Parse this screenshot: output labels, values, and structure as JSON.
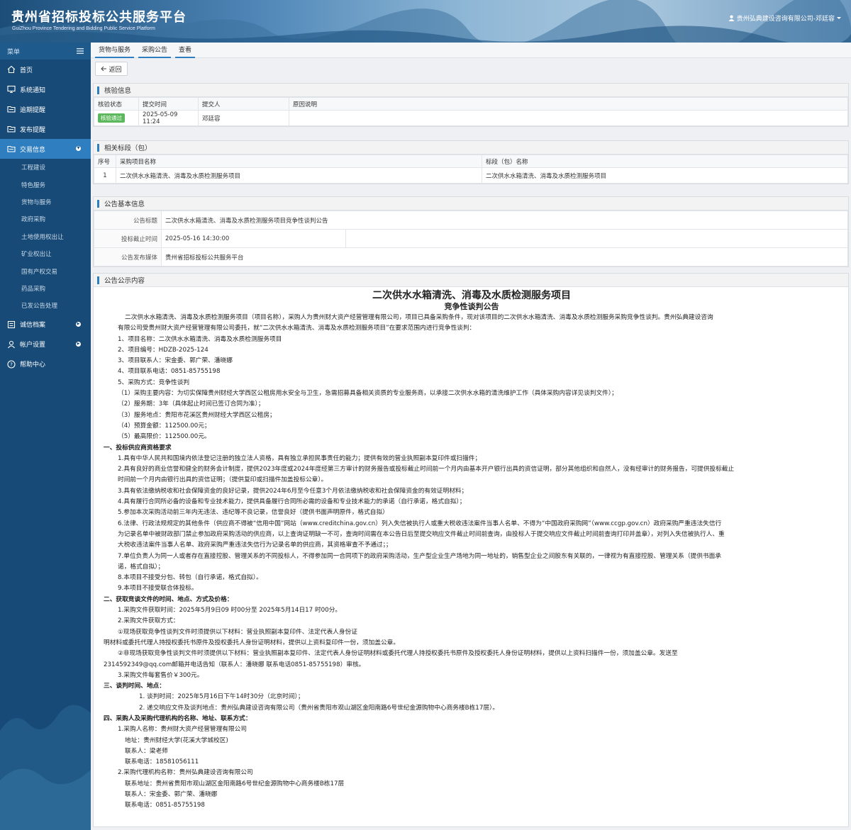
{
  "header": {
    "title": "贵州省招标投标公共服务平台",
    "subtitle": "GuiZhou Province Tendering and Bidding Public Service Platform",
    "user": "贵州弘典建设咨询有限公司-邓廷容"
  },
  "sidebar": {
    "menu_label": "菜单",
    "items": [
      {
        "label": "首页"
      },
      {
        "label": "系统通知"
      },
      {
        "label": "逾期提醒"
      },
      {
        "label": "发布提醒"
      },
      {
        "label": "交易信息"
      }
    ],
    "subitems": [
      "工程建设",
      "特色服务",
      "货物与服务",
      "政府采购",
      "土地使用权出让",
      "矿业权出让",
      "国有产权交易",
      "药品采购",
      "已发公告处理"
    ],
    "bottom": [
      {
        "label": "诚信档案"
      },
      {
        "label": "帐户设置"
      },
      {
        "label": "帮助中心"
      }
    ]
  },
  "breadcrumb": [
    "货物与服务",
    "采购公告",
    "查看"
  ],
  "back_label": "返回",
  "verify": {
    "title": "核验信息",
    "headers": [
      "核验状态",
      "提交时间",
      "提交人",
      "原因说明"
    ],
    "status": "核验通过",
    "time": "2025-05-09 11:24",
    "person": "邓廷容",
    "reason": ""
  },
  "sections": {
    "title": "相关标段（包）",
    "headers": [
      "序号",
      "采购项目名称",
      "标段（包）名称"
    ],
    "row": {
      "no": "1",
      "project": "二次供水水箱清洗、消毒及水质检测服务项目",
      "section": "二次供水水箱清洗、消毒及水质检测服务项目"
    }
  },
  "basic": {
    "title": "公告基本信息",
    "k1": "公告标题",
    "v1": "二次供水水箱清洗、消毒及水质检测服务项目竞争性谈判公告",
    "k2": "投标截止时间",
    "v2": "2025-05-16 14:30:00",
    "k3": "公告发布媒体",
    "v3": "贵州省招标投标公共服务平台"
  },
  "content": {
    "title": "公告公示内容",
    "h1": "二次供水水箱清洗、消毒及水质检测服务项目",
    "h2": "竞争性谈判公告",
    "lines": [
      "二次供水水箱清洗、消毒及水质检测服务项目（项目名称），采购人为贵州财大资产经营管理有限公司，项目已具备采购条件，现对该项目的二次供水水箱清洗、消毒及水质检测服务采购竞争性谈判。贵州弘典建设咨询",
      "有限公司受贵州财大资产经营管理有限公司委托，就“二次供水水箱清洗、消毒及水质检测服务项目”在要求范围内进行竞争性谈判：",
      "1、项目名称：二次供水水箱清洗、消毒及水质检测服务项目",
      "2、项目编号：HDZB-2025-124",
      "3、项目联系人：宋金委、郭广荣、潘晓娜",
      "4、项目联系电话：0851-85755198",
      "5、采购方式：竞争性谈判",
      "（1）采购主要内容：为切实保障贵州财经大学西区公租房用水安全与卫生，急需招募具备相关资质的专业服务商，以承接二次供水水箱的清洗维护工作（具体采购内容详见谈判文件）；",
      "（2）服务期：3年（具体起止时间已签订合同为准）；",
      "（3）服务地点：贵阳市花溪区贵州财经大学西区公租房；",
      "（4）预算金额：112500.00元；",
      "（5）最高限价：112500.00元。",
      "一、投标供应商资格要求",
      "1.具有中华人民共和国境内依法登记注册的独立法人资格，具有独立承担民事责任的能力；提供有效的营业执照副本复印件或扫描件；",
      "2.具有良好的商业信誉和健全的财务会计制度，提供2023年度或2024年度经第三方审计的财务报告或投标截止时间前一个月内由基本开户银行出具的资信证明，部分其他组织和自然人，没有经审计的财务报告，可提供投标截止",
      "时间前一个月内由银行出具的资信证明；（提供复印或扫描件加盖投标公章）。",
      "3.具有依法缴纳税收和社会保障资金的良好记录，提供2024年6月至今任意3个月依法缴纳税收和社会保障资金的有效证明材料；",
      "4.具有履行合同所必备的设备和专业技术能力，提供具备履行合同所必需的设备和专业技术能力的承诺（自行承诺，格式自拟）；",
      "5.参加本次采购活动前三年内无违法、违纪等不良记录，信誉良好（提供书面声明原件，格式自拟）",
      "6.法律、行政法规规定的其他条件（供应商不得被“信用中国”网站（www.creditchina.gov.cn）列入失信被执行人或重大税收违法案件当事人名单、不得为“中国政府采购网”（www.ccgp.gov.cn）政府采购严重违法失信行",
      "为记录名单中被财政部门禁止参加政府采购活动的供应商，以上查询证明缺一不可，查询时间需在本公告日后至提交响应文件截止时间前查询，由投标人于提交响应文件截止时间前查询打印并盖章），对列入失信被执行人、重",
      "大税收违法案件当事人名单、政府采购严重违法失信行为记录名单的供应商，其资格审查不予通过；；",
      "7.单位负责人为同一人或者存在直接控股、管理关系的不同投标人，不得参加同一合同项下的政府采购活动，生产型企业生产场地为同一地址的，销售型企业之间股东有关联的，一律视为有直接控股、管理关系（提供书面承",
      "诺，格式自拟）；",
      "8.本项目不接受分包、转包（自行承诺，格式自拟）。",
      "9.本项目不接受联合体投标。",
      "二、获取竞谈文件的时间、地点、方式及价格：",
      "1.采购文件获取时间：2025年5月9日09 时00分至 2025年5月14日17 时00分。",
      "2.采购文件获取方式：",
      "①现场获取竞争性谈判文件时须提供以下材料：营业执照副本复印件、法定代表人身份证",
      "明材料或委托代理人持授权委托书原件及授权委托人身份证明材料，提供以上资料复印件一份，须加盖公章。",
      "②非现场获取竞争性谈判文件时须提供以下材料：营业执照副本复印件、法定代表人身份证明材料或委托代理人持授权委托书原件及授权委托人身份证明材料，提供以上资料扫描件一份，须加盖公章。发送至",
      "2314592349@qq.com邮箱并电话告知（联系人：潘晓娜  联系电话0851-85755198）审核。",
      "3.采购文件每套售价￥300元。",
      "三、谈判时间、地点：",
      "1. 谈判时间：2025年5月16日下午14时30分（北京时间）；",
      "2. 递交响应文件及谈判地点：贵州弘典建设咨询有限公司（贵州省贵阳市观山湖区金阳南路6号世纪金源购物中心商务楼B栋17层）。",
      "四、采购人及采购代理机构的名称、地址、联系方式：",
      "1.采购人名称：贵州财大资产经营管理有限公司",
      "地址：贵州财经大学(花溪大学城校区)",
      "联系人：梁老师",
      "联系电话：18581056111",
      "2.采购代理机构名称：贵州弘典建设咨询有限公司",
      "联系地址：贵州省贵阳市观山湖区金阳南路6号世纪金源购物中心商务楼B栋17层",
      "联系人：宋金委、郭广荣、潘晓娜",
      "联系电话：0851-85755198"
    ]
  },
  "colors": {
    "sidebar": "#174a76",
    "accent": "#2f7fc0",
    "badge": "#5cb85c"
  }
}
